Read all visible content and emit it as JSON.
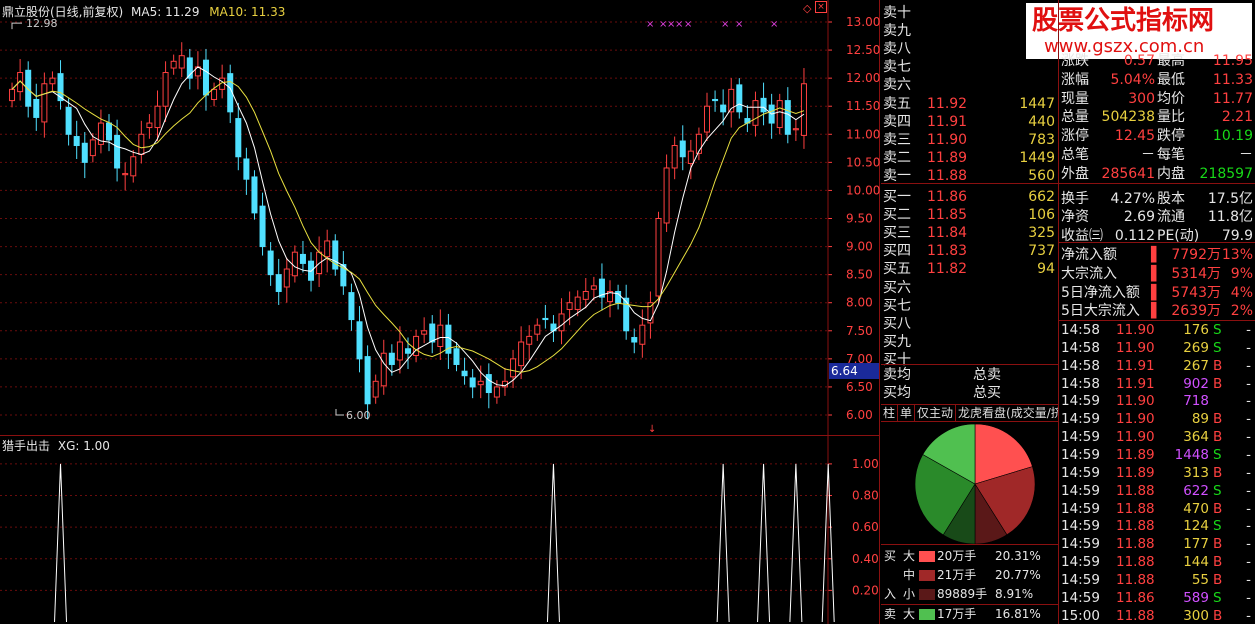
{
  "main_header": {
    "title": "鼎立股份(日线,前复权)",
    "ma5_label": "MA5:",
    "ma5_value": "11.29",
    "ma10_label": "MA10:",
    "ma10_value": "11.33"
  },
  "price_labels": {
    "high_mark": "12.98",
    "low_mark": "6.00",
    "cursor_price": "6.64"
  },
  "y_axis_main": [
    "13.00",
    "12.50",
    "12.00",
    "11.50",
    "11.00",
    "10.50",
    "10.00",
    "9.50",
    "9.00",
    "8.50",
    "8.00",
    "7.50",
    "7.00",
    "6.50",
    "6.00"
  ],
  "indicator": {
    "title": "猎手出击",
    "xg_label": "XG: 1.00",
    "y_axis": [
      "1.00",
      "0.80",
      "0.60",
      "0.40",
      "0.20"
    ]
  },
  "signal_marks": "×",
  "watermark": {
    "line1": "股票公式指标网",
    "line2": "www.gszx.com.cn"
  },
  "colors": {
    "up": "#ff4040",
    "down": "#50e0ff",
    "ma5": "#ffffff",
    "ma10": "#e8e040",
    "grid": "#6a0c0c",
    "border": "#8a1010"
  },
  "chart_data": [
    {
      "type": "candlestick",
      "title": "鼎立股份(日线,前复权)",
      "ylim": [
        5.9,
        13.2
      ],
      "series": [
        {
          "name": "close",
          "values": [
            11.8,
            12.1,
            11.5,
            11.3,
            11.9,
            12.0,
            11.6,
            11.0,
            10.8,
            10.5,
            10.9,
            11.2,
            10.9,
            10.4,
            10.3,
            10.6,
            11.0,
            11.2,
            11.5,
            12.1,
            12.3,
            12.4,
            12.0,
            12.2,
            11.7,
            11.8,
            12.0,
            11.4,
            10.6,
            10.2,
            9.6,
            9.0,
            8.5,
            8.2,
            8.6,
            8.9,
            8.7,
            8.4,
            8.9,
            9.1,
            8.6,
            8.3,
            7.7,
            7.0,
            6.2,
            6.6,
            7.1,
            6.9,
            7.3,
            7.1,
            7.4,
            7.5,
            7.3,
            7.6,
            7.1,
            6.9,
            6.7,
            6.5,
            6.6,
            6.4,
            6.5,
            6.6,
            7.0,
            7.3,
            7.4,
            7.6,
            7.7,
            7.5,
            7.8,
            8.0,
            8.1,
            8.2,
            8.3,
            8.1,
            8.2,
            8.0,
            7.5,
            7.3,
            7.6,
            8.0,
            9.5,
            10.4,
            10.8,
            10.6,
            10.7,
            11.0,
            11.5,
            11.6,
            11.4,
            11.8,
            11.4,
            11.2,
            11.6,
            11.4,
            11.2,
            11.6,
            11.0,
            11.1,
            11.9
          ]
        },
        {
          "name": "MA5",
          "values": [
            11.29
          ]
        },
        {
          "name": "MA10",
          "values": [
            11.33
          ]
        }
      ]
    },
    {
      "type": "line",
      "title": "猎手出击",
      "ylim": [
        0,
        1.05
      ],
      "series": [
        {
          "name": "XG",
          "spike_indices": [
            6,
            67,
            88,
            93,
            97,
            101
          ]
        }
      ]
    },
    {
      "type": "pie",
      "slices": [
        {
          "label": "买入大",
          "value": 20.31,
          "color": "#ff5050"
        },
        {
          "label": "买入中",
          "value": 20.77,
          "color": "#a02828"
        },
        {
          "label": "买入小",
          "value": 8.91,
          "color": "#5a1818"
        },
        {
          "label": "卖出小",
          "value": 8.91,
          "color": "#184a18"
        },
        {
          "label": "卖出中",
          "value": 24.29,
          "color": "#2a8a2a"
        },
        {
          "label": "卖出大",
          "value": 16.81,
          "color": "#50c050"
        }
      ]
    }
  ],
  "order_book": {
    "sell": [
      {
        "label": "卖十",
        "price": "",
        "vol": ""
      },
      {
        "label": "卖九",
        "price": "",
        "vol": ""
      },
      {
        "label": "卖八",
        "price": "",
        "vol": ""
      },
      {
        "label": "卖七",
        "price": "",
        "vol": ""
      },
      {
        "label": "卖六",
        "price": "",
        "vol": ""
      },
      {
        "label": "卖五",
        "price": "11.92",
        "vol": "1447"
      },
      {
        "label": "卖四",
        "price": "11.91",
        "vol": "440"
      },
      {
        "label": "卖三",
        "price": "11.90",
        "vol": "783"
      },
      {
        "label": "卖二",
        "price": "11.89",
        "vol": "1449"
      },
      {
        "label": "卖一",
        "price": "11.88",
        "vol": "560"
      }
    ],
    "buy": [
      {
        "label": "买一",
        "price": "11.86",
        "vol": "662"
      },
      {
        "label": "买二",
        "price": "11.85",
        "vol": "106"
      },
      {
        "label": "买三",
        "price": "11.84",
        "vol": "325"
      },
      {
        "label": "买四",
        "price": "11.83",
        "vol": "737"
      },
      {
        "label": "买五",
        "price": "11.82",
        "vol": "94"
      },
      {
        "label": "买六",
        "price": "",
        "vol": ""
      },
      {
        "label": "买七",
        "price": "",
        "vol": ""
      },
      {
        "label": "买八",
        "price": "",
        "vol": ""
      },
      {
        "label": "买九",
        "price": "",
        "vol": ""
      },
      {
        "label": "买十",
        "price": "",
        "vol": ""
      }
    ],
    "avg_sell": "卖均",
    "total_sell": "总卖",
    "avg_buy": "买均",
    "total_buy": "总买"
  },
  "tabs": [
    "柱",
    "单",
    "仅主动",
    "龙虎看盘(成交量/挤"
  ],
  "flow": [
    {
      "side": "买",
      "size": "大",
      "amount": "20万手",
      "pct": "20.31%",
      "color": "#ff5050"
    },
    {
      "side": "",
      "size": "中",
      "amount": "21万手",
      "pct": "20.77%",
      "color": "#a02828"
    },
    {
      "side": "入",
      "size": "小",
      "amount": "89889手",
      "pct": "8.91%",
      "color": "#5a1818"
    },
    {
      "side": "卖",
      "size": "大",
      "amount": "17万手",
      "pct": "16.81%",
      "color": "#50c050"
    }
  ],
  "quote": [
    {
      "l": "涨跌",
      "v": "0.57",
      "l2": "最高",
      "v2": "11.95",
      "c": "red",
      "c2": "red"
    },
    {
      "l": "涨幅",
      "v": "5.04%",
      "l2": "最低",
      "v2": "11.33",
      "c": "red",
      "c2": "red"
    },
    {
      "l": "现量",
      "v": "300",
      "l2": "均价",
      "v2": "11.77",
      "c": "red",
      "c2": "red"
    },
    {
      "l": "总量",
      "v": "504238",
      "l2": "量比",
      "v2": "2.21",
      "c": "yellow",
      "c2": "red"
    },
    {
      "l": "涨停",
      "v": "12.45",
      "l2": "跌停",
      "v2": "10.19",
      "c": "red",
      "c2": "green"
    },
    {
      "l": "总笔",
      "v": "－",
      "l2": "每笔",
      "v2": "－",
      "c": "white",
      "c2": "white"
    },
    {
      "l": "外盘",
      "v": "285641",
      "l2": "内盘",
      "v2": "218597",
      "c": "red",
      "c2": "green"
    },
    {
      "l": "换手",
      "v": "4.27%",
      "l2": "股本",
      "v2": "17.5亿",
      "c": "white",
      "c2": "white"
    },
    {
      "l": "净资",
      "v": "2.69",
      "l2": "流通",
      "v2": "11.8亿",
      "c": "white",
      "c2": "white"
    },
    {
      "l": "收益㈢",
      "v": "0.112",
      "l2": "PE(动)",
      "v2": "79.9",
      "c": "white",
      "c2": "white"
    }
  ],
  "capital_flow": [
    {
      "l": "净流入额",
      "v": "7792万",
      "p": "13%"
    },
    {
      "l": "大宗流入",
      "v": "5314万",
      "p": "9%"
    },
    {
      "l": "5日净流入额",
      "v": "5743万",
      "p": "4%"
    },
    {
      "l": "5日大宗流入",
      "v": "2639万",
      "p": "2%"
    }
  ],
  "ticks": [
    {
      "t": "14:58",
      "p": "11.90",
      "v": "176",
      "s": "S",
      "vc": "yellow"
    },
    {
      "t": "14:58",
      "p": "11.90",
      "v": "269",
      "s": "S",
      "vc": "yellow"
    },
    {
      "t": "14:58",
      "p": "11.91",
      "v": "267",
      "s": "B",
      "vc": "yellow"
    },
    {
      "t": "14:58",
      "p": "11.91",
      "v": "902",
      "s": "B",
      "vc": "purple"
    },
    {
      "t": "14:59",
      "p": "11.90",
      "v": "718",
      "s": "",
      "vc": "purple"
    },
    {
      "t": "14:59",
      "p": "11.90",
      "v": "89",
      "s": "B",
      "vc": "yellow"
    },
    {
      "t": "14:59",
      "p": "11.90",
      "v": "364",
      "s": "B",
      "vc": "yellow"
    },
    {
      "t": "14:59",
      "p": "11.89",
      "v": "1448",
      "s": "S",
      "vc": "purple"
    },
    {
      "t": "14:59",
      "p": "11.89",
      "v": "313",
      "s": "B",
      "vc": "yellow"
    },
    {
      "t": "14:59",
      "p": "11.88",
      "v": "622",
      "s": "S",
      "vc": "purple"
    },
    {
      "t": "14:59",
      "p": "11.88",
      "v": "470",
      "s": "B",
      "vc": "yellow"
    },
    {
      "t": "14:59",
      "p": "11.88",
      "v": "124",
      "s": "S",
      "vc": "yellow"
    },
    {
      "t": "14:59",
      "p": "11.88",
      "v": "177",
      "s": "B",
      "vc": "yellow"
    },
    {
      "t": "14:59",
      "p": "11.88",
      "v": "144",
      "s": "B",
      "vc": "yellow"
    },
    {
      "t": "14:59",
      "p": "11.88",
      "v": "55",
      "s": "B",
      "vc": "yellow"
    },
    {
      "t": "14:59",
      "p": "11.86",
      "v": "589",
      "s": "S",
      "vc": "purple"
    },
    {
      "t": "15:00",
      "p": "11.88",
      "v": "300",
      "s": "B",
      "vc": "yellow"
    }
  ]
}
